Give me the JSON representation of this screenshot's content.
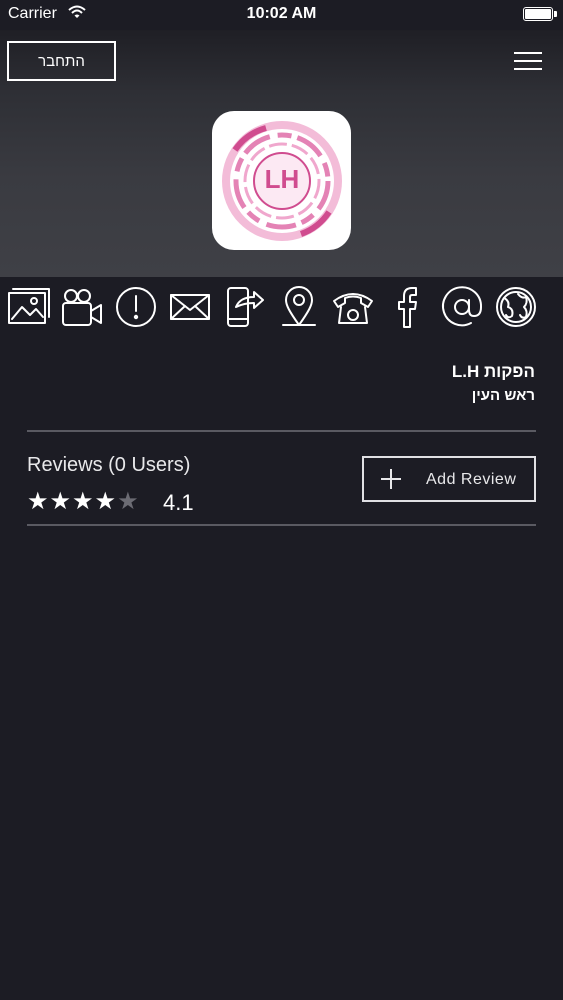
{
  "status_bar": {
    "carrier": "Carrier",
    "time": "10:02 AM",
    "battery_level": 1.0
  },
  "header": {
    "login_label": "התחבר",
    "menu_icon": "hamburger-menu-icon",
    "logo_text": "LH",
    "logo_color": "#d04c8f"
  },
  "icon_bar": {
    "items": [
      {
        "name": "gallery-icon"
      },
      {
        "name": "video-icon"
      },
      {
        "name": "info-icon"
      },
      {
        "name": "mail-icon"
      },
      {
        "name": "share-phone-icon"
      },
      {
        "name": "location-pin-icon"
      },
      {
        "name": "telephone-icon"
      },
      {
        "name": "facebook-icon"
      },
      {
        "name": "at-sign-icon"
      },
      {
        "name": "globe-icon"
      }
    ]
  },
  "business": {
    "name": "הפקות L.H",
    "city": "ראש העין"
  },
  "reviews": {
    "title": "Reviews (0 Users)",
    "rating": "4.1",
    "filled_stars": 4,
    "total_stars": 5,
    "add_review_label": "Add Review"
  },
  "colors": {
    "background": "#1c1c24",
    "accent_logo": "#d04c8f",
    "divider": "#5a5a62"
  }
}
